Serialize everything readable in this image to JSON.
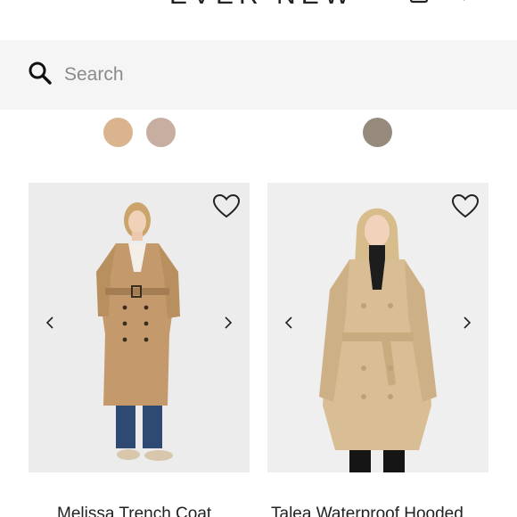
{
  "header": {
    "brand": "EVER NEW",
    "bag_icon": "shopping-bag-icon",
    "menu_icon": "menu-icon"
  },
  "search": {
    "placeholder": "Search",
    "value": "",
    "icon": "search-icon"
  },
  "swatches": {
    "product_1": [
      "#d9b48f",
      "#c7aea0"
    ],
    "product_2": [
      "#958a7c"
    ]
  },
  "products": [
    {
      "name": "Melissa Trench Coat",
      "wishlist_icon": "heart-icon",
      "prev_icon": "chevron-left-icon",
      "next_icon": "chevron-right-icon"
    },
    {
      "name": "Talea Waterproof Hooded",
      "wishlist_icon": "heart-icon",
      "prev_icon": "chevron-left-icon",
      "next_icon": "chevron-right-icon"
    }
  ],
  "colors": {
    "search_bg": "#f5f5f5",
    "text": "#222222",
    "placeholder": "#8a8a8a"
  }
}
